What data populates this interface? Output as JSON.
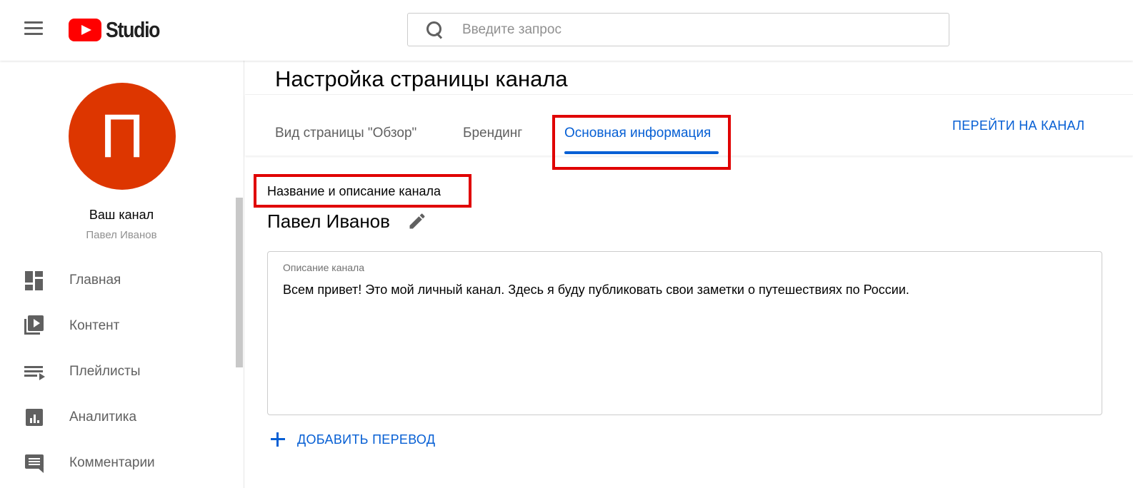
{
  "header": {
    "logo_text": "Studio",
    "search_placeholder": "Введите запрос"
  },
  "sidebar": {
    "avatar_letter": "П",
    "channel_title": "Ваш канал",
    "channel_name": "Павел Иванов",
    "items": [
      {
        "label": "Главная",
        "icon": "dashboard-icon"
      },
      {
        "label": "Контент",
        "icon": "video-library-icon"
      },
      {
        "label": "Плейлисты",
        "icon": "playlist-icon"
      },
      {
        "label": "Аналитика",
        "icon": "analytics-icon"
      },
      {
        "label": "Комментарии",
        "icon": "comments-icon"
      }
    ]
  },
  "main": {
    "page_title": "Настройка страницы канала",
    "tabs": [
      {
        "label": "Вид страницы \"Обзор\"",
        "active": false
      },
      {
        "label": "Брендинг",
        "active": false
      },
      {
        "label": "Основная информация",
        "active": true
      }
    ],
    "goto_channel": "ПЕРЕЙТИ НА КАНАЛ",
    "section_label": "Название и описание канала",
    "channel_name": "Павел Иванов",
    "description_label": "Описание канала",
    "description_text": "Всем привет! Это мой личный канал. Здесь я буду публиковать свои заметки о путешествиях по России.",
    "add_translation": "ДОБАВИТЬ ПЕРЕВОД"
  },
  "colors": {
    "accent": "#065fd4",
    "avatar": "#dd3600",
    "highlight": "#e00000",
    "youtube_red": "#ff0000"
  }
}
